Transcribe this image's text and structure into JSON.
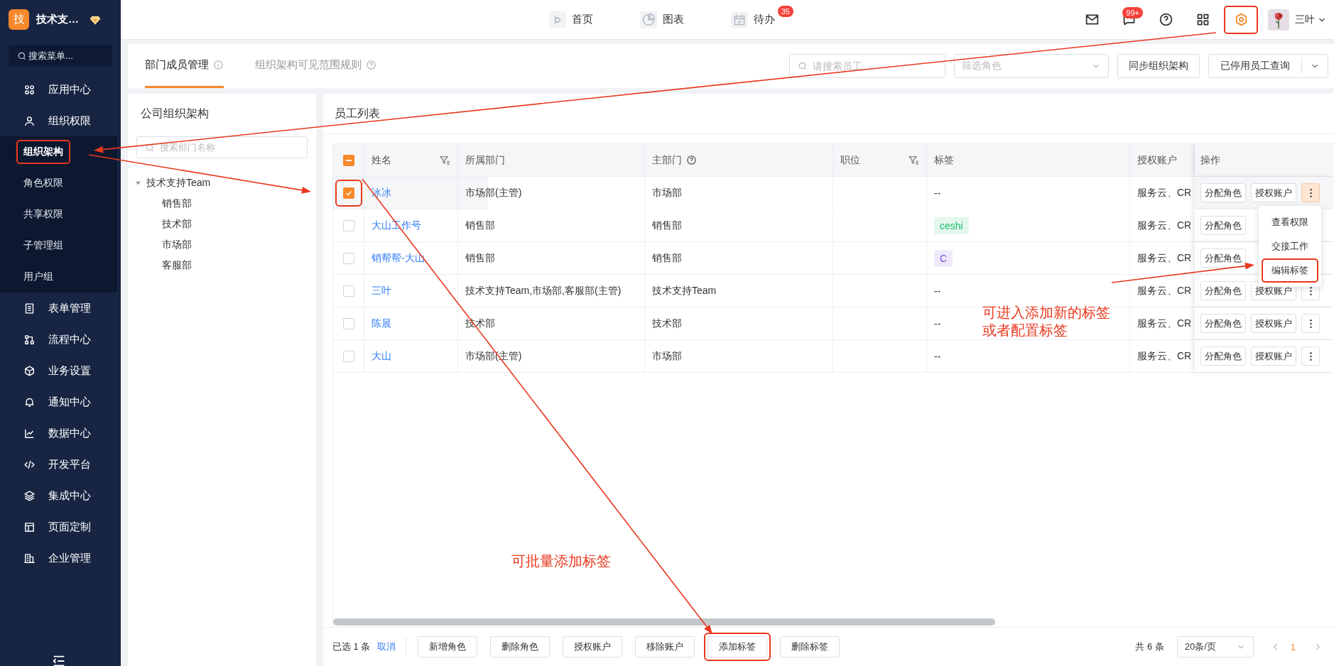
{
  "sidebar": {
    "logo": "技",
    "company": "技术支…",
    "search": {
      "placeholder": "搜索菜单..."
    },
    "menu": [
      {
        "label": "应用中心"
      },
      {
        "label": "组织权限",
        "expanded": true,
        "children": [
          {
            "label": "组织架构",
            "selected": true,
            "highlighted": true
          },
          {
            "label": "角色权限",
            "selected": false,
            "highlighted": false
          },
          {
            "label": "共享权限",
            "selected": false,
            "highlighted": false
          },
          {
            "label": "子管理组",
            "selected": false,
            "highlighted": false
          },
          {
            "label": "用户组",
            "selected": false,
            "highlighted": false
          }
        ]
      },
      {
        "label": "表单管理"
      },
      {
        "label": "流程中心"
      },
      {
        "label": "业务设置"
      },
      {
        "label": "通知中心"
      },
      {
        "label": "数据中心"
      },
      {
        "label": "开发平台"
      },
      {
        "label": "集成中心"
      },
      {
        "label": "页面定制"
      },
      {
        "label": "企业管理"
      }
    ]
  },
  "top_nav": [
    {
      "label": "首页"
    },
    {
      "label": "图表"
    },
    {
      "label": "待办",
      "badge": "35"
    }
  ],
  "top_tools": [
    {
      "highlighted": false
    },
    {
      "badge": "99+",
      "highlighted": false
    },
    {
      "highlighted": false
    },
    {
      "highlighted": false
    },
    {
      "highlighted": true
    }
  ],
  "user": {
    "name": "三叶"
  },
  "tabs": [
    {
      "label": "部门成员管理",
      "selected": true
    },
    {
      "label": "组织架构可见范围规则",
      "selected": false
    }
  ],
  "toolbar": {
    "search": {
      "placeholder": "请搜索员工"
    },
    "role_filter": {
      "placeholder": "筛选角色"
    },
    "sync_button": "同步组织架构",
    "disabled_query": "已停用员工查询"
  },
  "org_panel": {
    "title": "公司组织架构",
    "search": {
      "placeholder": "搜索部门名称"
    },
    "tree": [
      {
        "label": "技术支持Team",
        "expanded": true,
        "children": [
          {
            "label": "销售部"
          },
          {
            "label": "技术部"
          },
          {
            "label": "市场部"
          },
          {
            "label": "客服部"
          }
        ]
      }
    ]
  },
  "table": {
    "title": "员工列表",
    "select_all": {
      "indeterminate": true
    },
    "columns": [
      {
        "label": "姓名",
        "filter": true
      },
      {
        "label": "所属部门"
      },
      {
        "label": "主部门",
        "help": true
      },
      {
        "label": "职位",
        "filter": true
      },
      {
        "label": "标签"
      },
      {
        "label": "授权账户"
      },
      {
        "label": "操作"
      }
    ],
    "rows": [
      {
        "selected": true,
        "highlighted": true,
        "name": "冰冰",
        "department": "市场部(主管)",
        "main_department": "市场部",
        "tag": "--",
        "account": "服务云、CR",
        "actions": [
          "分配角色",
          "授权账户"
        ],
        "menu_open": true
      },
      {
        "selected": false,
        "highlighted": false,
        "name": "大山工作号",
        "department": "销售部",
        "main_department": "销售部",
        "tag": "ceshi",
        "color": "#19be6b",
        "account": "服务云、CR",
        "actions": [
          "分配角色"
        ]
      },
      {
        "selected": false,
        "highlighted": false,
        "name": "销帮帮-大山",
        "department": "销售部",
        "main_department": "销售部",
        "tag": "C",
        "color": "#7b4fe0",
        "account": "服务云、CR",
        "actions": [
          "分配角色"
        ]
      },
      {
        "selected": false,
        "highlighted": false,
        "name": "三叶",
        "department": "技术支持Team,市场部,客服部(主管)",
        "main_department": "技术支持Team",
        "tag": "--",
        "account": "服务云、CR",
        "actions": [
          "分配角色",
          "授权账户"
        ],
        "menu_open": false
      },
      {
        "selected": false,
        "highlighted": false,
        "name": "陈晨",
        "department": "技术部",
        "main_department": "技术部",
        "tag": "--",
        "account": "服务云、CR",
        "actions": [
          "分配角色",
          "授权账户"
        ],
        "menu_open": false
      },
      {
        "selected": false,
        "highlighted": false,
        "name": "大山",
        "department": "市场部(主管)",
        "main_department": "市场部",
        "tag": "--",
        "account": "服务云、CR",
        "actions": [
          "分配角色",
          "授权账户"
        ],
        "menu_open": false
      }
    ],
    "row_menu": [
      {
        "label": "查看权限",
        "highlighted": false
      },
      {
        "label": "交接工作",
        "highlighted": false
      },
      {
        "label": "编辑标签",
        "highlighted": true
      }
    ]
  },
  "footer": {
    "selected_count": "已选 1 条",
    "cancel": "取消",
    "buttons": [
      {
        "label": "新增角色",
        "highlighted": false
      },
      {
        "label": "删除角色",
        "highlighted": false
      },
      {
        "label": "授权账户",
        "highlighted": false
      },
      {
        "label": "移除账户",
        "highlighted": false
      },
      {
        "label": "添加标签",
        "highlighted": true
      },
      {
        "label": "删除标签",
        "highlighted": false
      }
    ],
    "total": "共 6 条",
    "page_size": "20条/页",
    "pages": [
      {
        "label": "1",
        "selected": true
      }
    ]
  },
  "annotations": [
    {
      "text": "可进入添加新的标签或者配置标签"
    },
    {
      "text": "可批量添加标签"
    }
  ]
}
